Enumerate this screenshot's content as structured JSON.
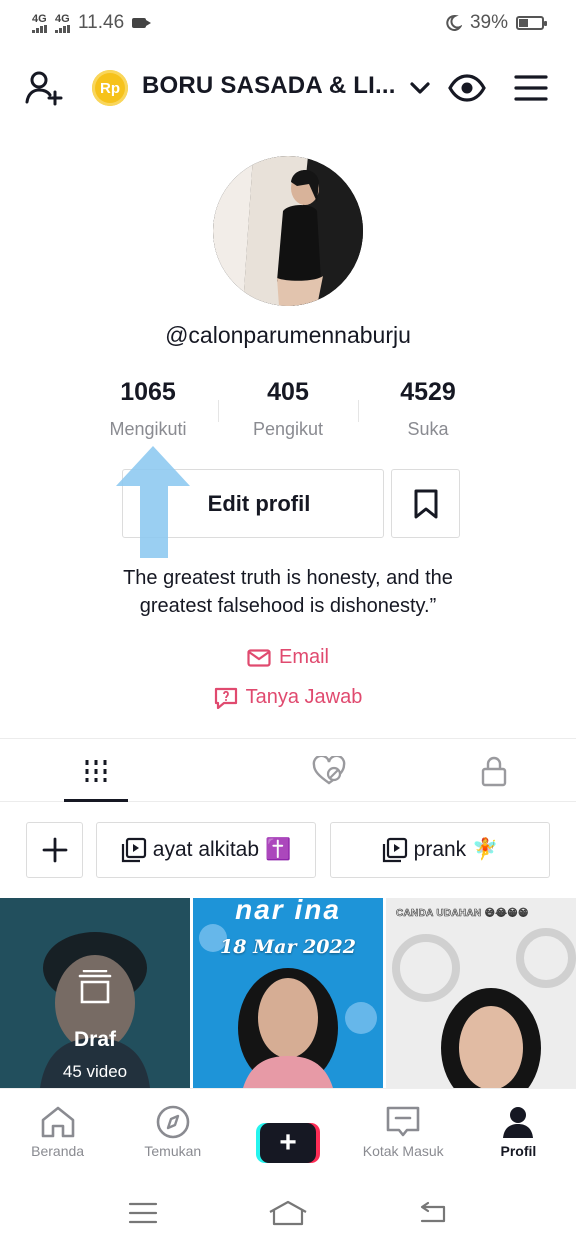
{
  "status_bar": {
    "net1": "4G",
    "net2": "4G",
    "time": "11.46",
    "battery": "39%"
  },
  "header": {
    "title": "BORU SASADA & LI...",
    "coin_label": "Rp"
  },
  "profile": {
    "username": "@calonparumennaburju",
    "stats": [
      {
        "value": "1065",
        "label": "Mengikuti"
      },
      {
        "value": "405",
        "label": "Pengikut"
      },
      {
        "value": "4529",
        "label": "Suka"
      }
    ],
    "edit_label": "Edit profil",
    "bio_line1": "The greatest truth is honesty, and the",
    "bio_line2": "greatest falsehood is dishonesty.”",
    "email_label": "Email",
    "qa_label": "Tanya Jawab"
  },
  "playlists": [
    {
      "label": "ayat alkitab",
      "emoji": "✝️"
    },
    {
      "label": "prank",
      "emoji": "🧚"
    }
  ],
  "videos": [
    {
      "overlay_label": "Draf",
      "overlay_count": "45 video"
    },
    {
      "caption_top": "nar ina",
      "date": "18 Mar 2022"
    },
    {
      "caption": "CANDA UDAHAN 😅😂😁😁"
    }
  ],
  "bottom_nav": {
    "home": "Beranda",
    "discover": "Temukan",
    "inbox": "Kotak Masuk",
    "profile": "Profil"
  },
  "colors": {
    "accent_pink": "#e04a6f",
    "brand_red": "#fe2c55",
    "brand_cyan": "#25f4ee",
    "coin_yellow": "#f6c21b"
  },
  "icons": {
    "add_user": "add-user-icon",
    "eye": "eye-icon",
    "menu": "hamburger-menu-icon",
    "bookmark": "bookmark-icon",
    "grid": "grid-icon",
    "liked": "liked-heart-icon",
    "lock": "lock-icon",
    "playlist": "playlist-icon"
  }
}
